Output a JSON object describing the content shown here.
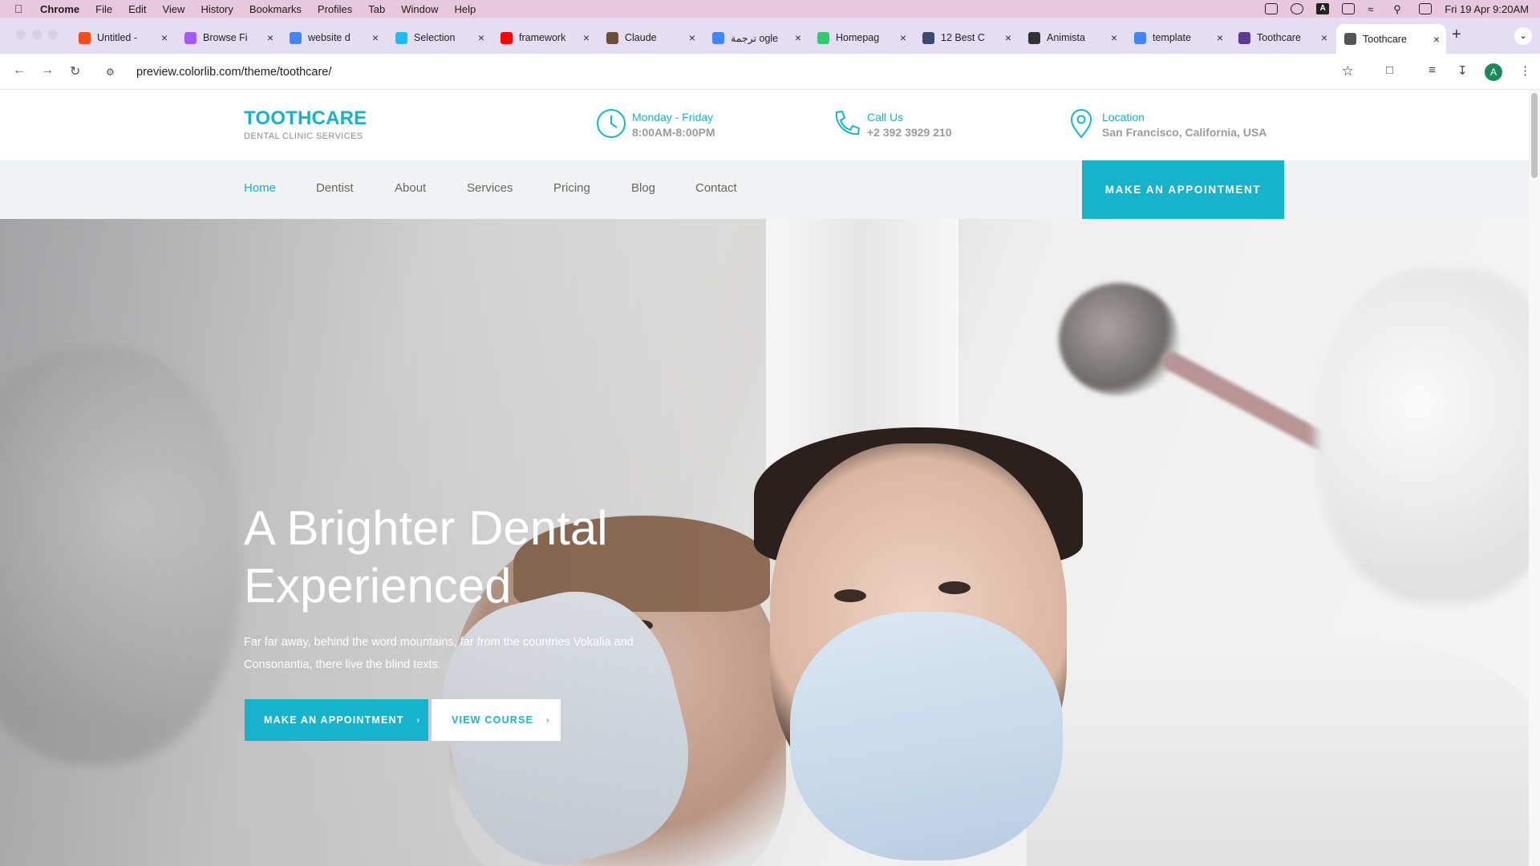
{
  "menubar": {
    "app": "Chrome",
    "items": [
      "File",
      "Edit",
      "View",
      "History",
      "Bookmarks",
      "Profiles",
      "Tab",
      "Window",
      "Help"
    ],
    "datetime": "Fri 19 Apr  9:20AM"
  },
  "tabs": [
    {
      "label": "Untitled -",
      "icon": "figma-icon",
      "color": "#f24e1e"
    },
    {
      "label": "Browse Fi",
      "icon": "figma-icon",
      "color": "#a259ff"
    },
    {
      "label": "website d",
      "icon": "google-icon",
      "color": "#4285f4"
    },
    {
      "label": "Selection",
      "icon": "figma-icon",
      "color": "#1abcfe"
    },
    {
      "label": "framework",
      "icon": "youtube-icon",
      "color": "#ff0000"
    },
    {
      "label": "Claude",
      "icon": "claude-icon",
      "color": "#6b4f3a"
    },
    {
      "label": "ترجمة ogle",
      "icon": "translate-icon",
      "color": "#4285f4"
    },
    {
      "label": "Homepag",
      "icon": "leaf-icon",
      "color": "#2ecc71"
    },
    {
      "label": "12 Best C",
      "icon": "cc-icon",
      "color": "#3b4a6b"
    },
    {
      "label": "Animista",
      "icon": "animista-icon",
      "color": "#333333"
    },
    {
      "label": "template",
      "icon": "google-icon",
      "color": "#4285f4"
    },
    {
      "label": "Toothcare",
      "icon": "colorlib-icon",
      "color": "#5a3b8c"
    },
    {
      "label": "Toothcare",
      "icon": "globe-icon",
      "color": "#555555",
      "active": true
    }
  ],
  "address": {
    "url": "preview.colorlib.com/theme/toothcare/",
    "avatar": "A"
  },
  "site": {
    "logo_title": "TOOTHCARE",
    "logo_sub": "DENTAL CLINIC SERVICES",
    "info": [
      {
        "label": "Monday - Friday",
        "value": "8:00AM-8:00PM",
        "icon": "clock-icon"
      },
      {
        "label": "Call Us",
        "value": "+2 392 3929 210",
        "icon": "phone-icon"
      },
      {
        "label": "Location",
        "value": "San Francisco, California, USA",
        "icon": "location-pin-icon"
      }
    ],
    "nav": [
      "Home",
      "Dentist",
      "About",
      "Services",
      "Pricing",
      "Blog",
      "Contact"
    ],
    "nav_active": "Home",
    "appointment_button": "MAKE AN APPOINTMENT",
    "accent": "#17b3cc"
  },
  "hero": {
    "title": "A Brighter Dental Experienced",
    "text": "Far far away, behind the word mountains, far from the countries Vokalia and Consonantia, there live the blind texts.",
    "primary_button": "MAKE AN APPOINTMENT",
    "secondary_button": "VIEW COURSE"
  }
}
